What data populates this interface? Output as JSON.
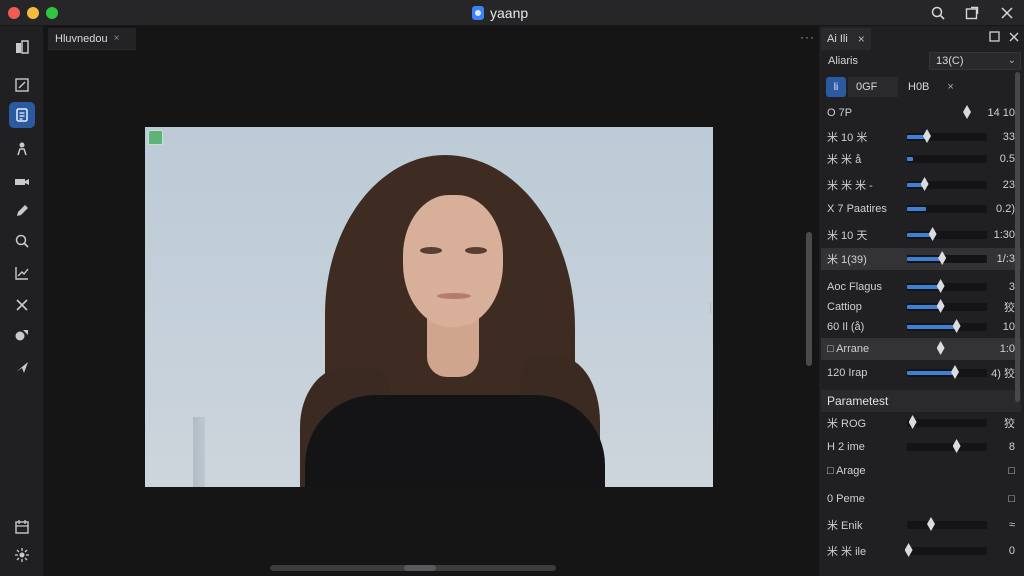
{
  "window": {
    "title": "yaanp"
  },
  "titlebar_icons": [
    "search-icon",
    "expand-icon",
    "close-icon"
  ],
  "canvas": {
    "tab_label": "Hluvnedou",
    "tab_close": "×",
    "menu_glyph": "···"
  },
  "panel": {
    "tab_label": "Ai Ili",
    "tab_close": "×",
    "preset_label": "Aliaris",
    "preset_value": "13(C)",
    "sub_icon_label": "li",
    "sub_tab1": "0GF",
    "sub_tab2": "H0B",
    "sub_close": "×",
    "rows": [
      {
        "label": "O 7P",
        "value": "14 10",
        "fill": 0.75,
        "thumb": 0.75,
        "track": false
      },
      {
        "label": "米 10 米",
        "value": "33",
        "fill": 0.25,
        "thumb": 0.25,
        "track": true
      },
      {
        "label": "米 米 å",
        "value": "0.5",
        "fill": 0.08,
        "thumb": null,
        "track": true
      },
      {
        "label": "米 米 米 -",
        "value": "23",
        "fill": 0.22,
        "thumb": 0.22,
        "track": true
      },
      {
        "label": "X 7 Paatires",
        "value": "0.2)",
        "fill": 0.24,
        "thumb": null,
        "track": true
      },
      {
        "label": "米 10 天",
        "value": "1:30",
        "fill": 0.32,
        "thumb": 0.32,
        "track": true
      },
      {
        "label": "米 1(39)",
        "value": "1/:3",
        "fill": 0.44,
        "thumb": 0.44,
        "track": true,
        "highlight": true
      },
      {
        "label": "Aoc Flagus",
        "value": "3",
        "fill": 0.42,
        "thumb": 0.42,
        "track": true
      },
      {
        "label": "Cattiop",
        "value": "狡",
        "fill": 0.42,
        "thumb": 0.42,
        "track": true
      },
      {
        "label": "60 Il (å)",
        "value": "10",
        "fill": 0.62,
        "thumb": 0.62,
        "track": true
      },
      {
        "label": "□ Arrane",
        "value": "1:0",
        "fill": 0.0,
        "thumb": 0.42,
        "track": false,
        "highlight": true
      },
      {
        "label": "120 Irap",
        "value": "4) 狡",
        "fill": 0.6,
        "thumb": 0.6,
        "track": true
      }
    ],
    "section_title": "Parametest",
    "rows2": [
      {
        "label": "米 ROG",
        "value": "狡",
        "thumb": 0.07
      },
      {
        "label": "H 2 ime",
        "value": "8",
        "thumb": 0.62
      },
      {
        "label": "□ Arage",
        "value": "□",
        "thumb": null
      },
      {
        "label": "0 Peme",
        "value": "□",
        "thumb": null
      },
      {
        "label": "米 Enik",
        "value": "≈",
        "thumb": 0.3
      },
      {
        "label": "米 米 ile",
        "value": "0",
        "thumb": 0.02
      }
    ]
  },
  "tools": [
    "layers-icon",
    "frame-icon",
    "document-icon",
    "person-icon",
    "camera-icon",
    "pencil-icon",
    "search-zoom-icon",
    "chart-icon",
    "cross-icon",
    "shapes-icon",
    "send-icon",
    "calendar-icon",
    "settings-icon"
  ]
}
